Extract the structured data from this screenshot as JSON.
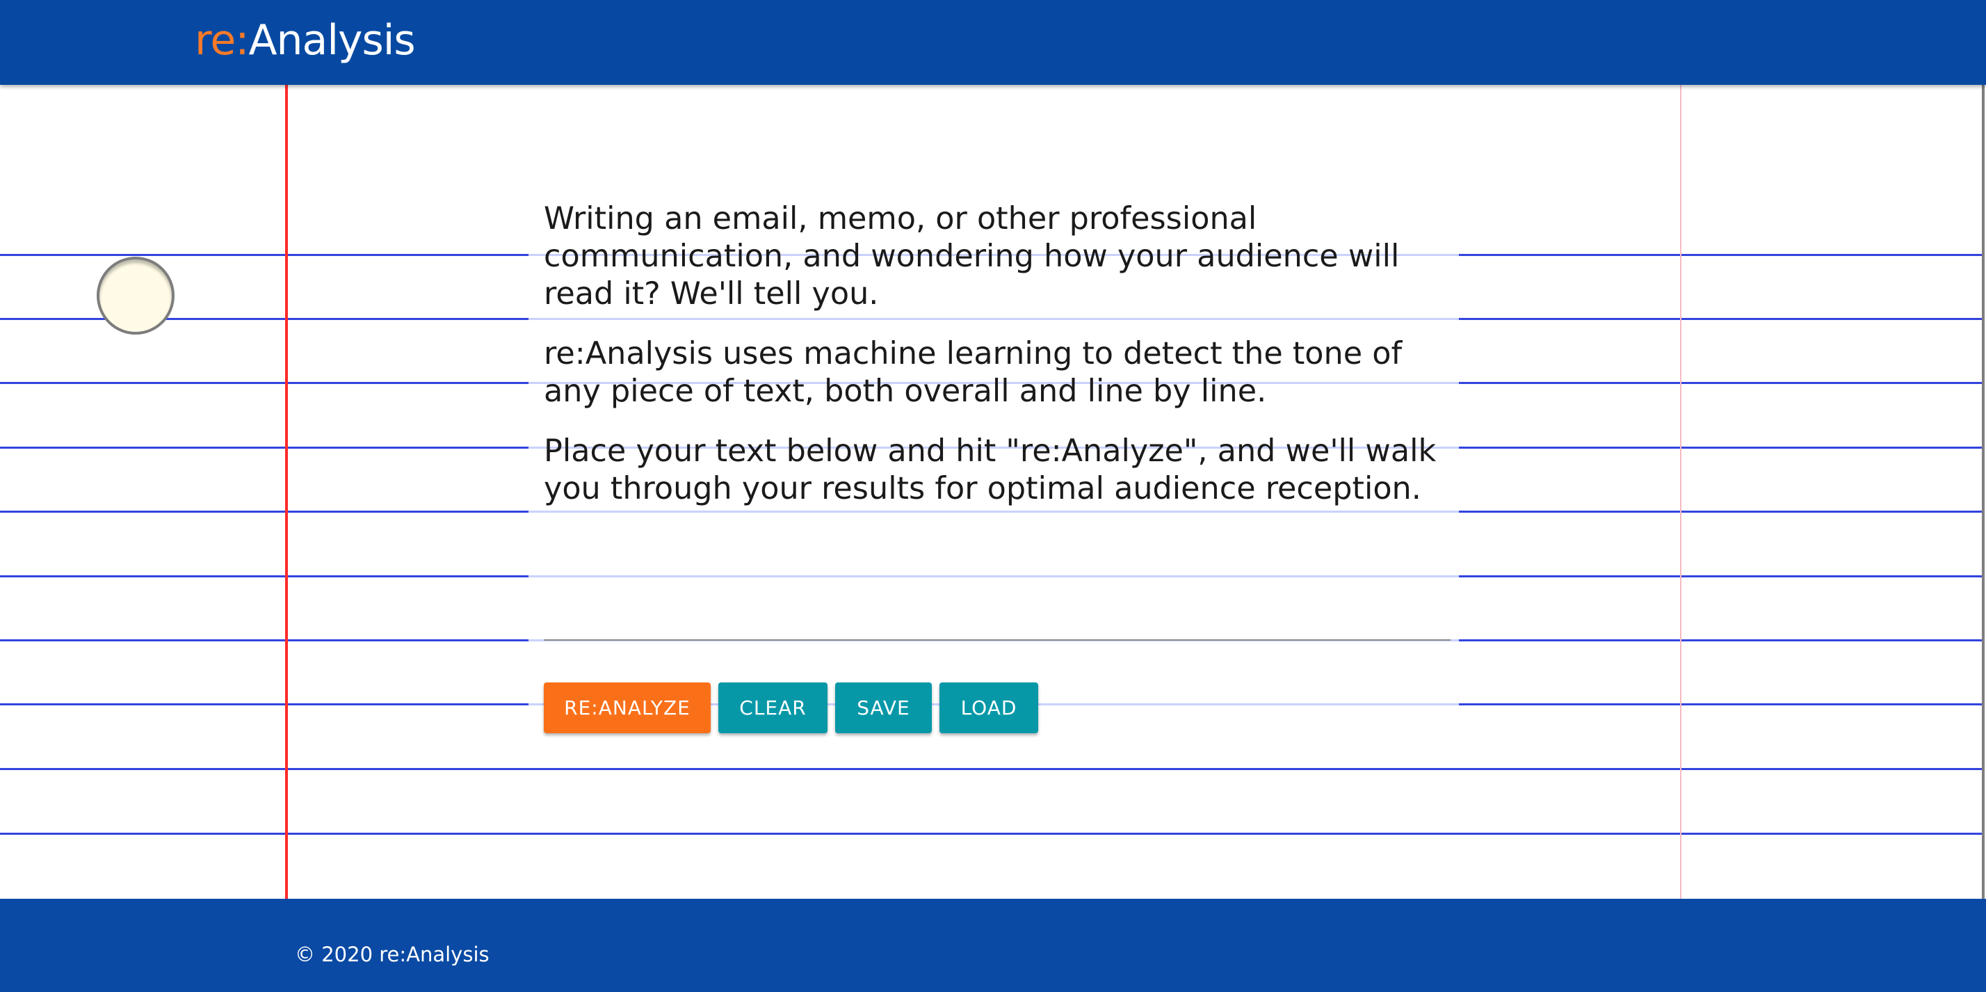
{
  "header": {
    "logo_prefix": "re:",
    "logo_name": "Analysis"
  },
  "main": {
    "paragraphs": [
      "Writing an email, memo, or other professional communication, and wondering how your audience will read it? We'll tell you.",
      "re:Analysis uses machine learning to detect the tone of any piece of text, both overall and line by line.",
      "Place your text below and hit \"re:Analyze\", and we'll walk you through your results for optimal audience reception."
    ],
    "text_input": {
      "value": "",
      "placeholder": ""
    },
    "buttons": {
      "analyze": "RE:ANALYZE",
      "clear": "CLEAR",
      "save": "SAVE",
      "load": "LOAD"
    }
  },
  "footer": {
    "copyright": "© 2020 re:Analysis"
  },
  "colors": {
    "header_bg": "#0749a2",
    "accent_orange": "#fa7019",
    "button_teal": "#0798a8",
    "rule_blue": "#3344dd",
    "margin_red": "#ff2a2a"
  }
}
